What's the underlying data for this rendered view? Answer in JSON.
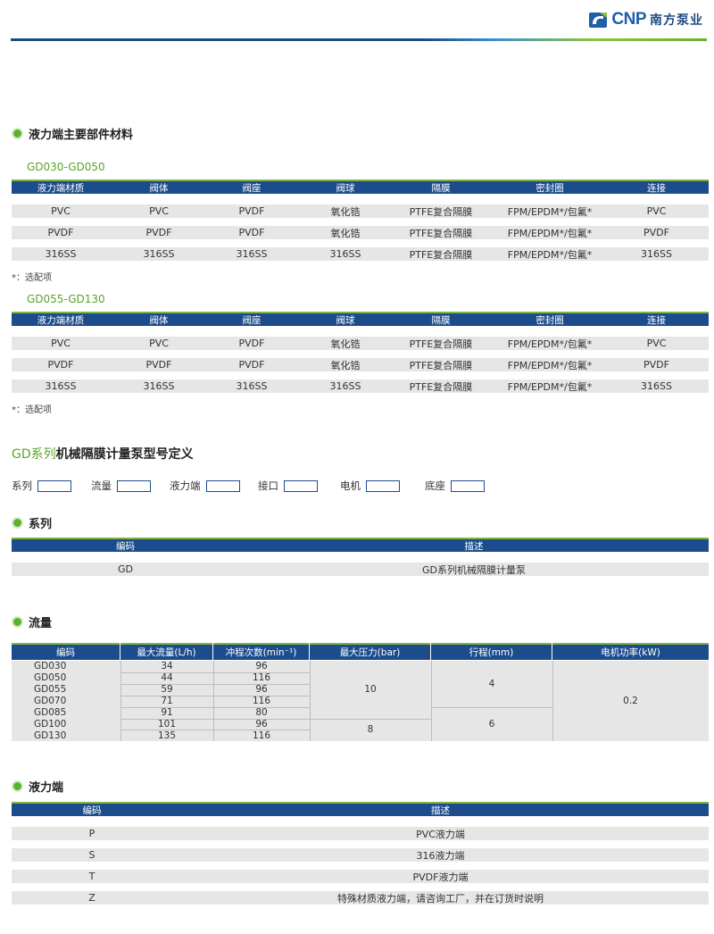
{
  "header": {
    "brand": "CNP",
    "brand_cn": "南方泵业"
  },
  "materials": {
    "title": "液力端主要部件材料",
    "columns": [
      "液力端材质",
      "阀体",
      "阀座",
      "阀球",
      "隔膜",
      "密封圈",
      "连接"
    ],
    "groups": [
      {
        "label": "GD030-GD050",
        "rows": [
          [
            "PVC",
            "PVC",
            "PVDF",
            "氧化锆",
            "PTFE复合隔膜",
            "FPM/EPDM*/包氟*",
            "PVC"
          ],
          [
            "PVDF",
            "PVDF",
            "PVDF",
            "氧化锆",
            "PTFE复合隔膜",
            "FPM/EPDM*/包氟*",
            "PVDF"
          ],
          [
            "316SS",
            "316SS",
            "316SS",
            "316SS",
            "PTFE复合隔膜",
            "FPM/EPDM*/包氟*",
            "316SS"
          ]
        ],
        "note": "*：选配项"
      },
      {
        "label": "GD055-GD130",
        "rows": [
          [
            "PVC",
            "PVC",
            "PVDF",
            "氧化锆",
            "PTFE复合隔膜",
            "FPM/EPDM*/包氟*",
            "PVC"
          ],
          [
            "PVDF",
            "PVDF",
            "PVDF",
            "氧化锆",
            "PTFE复合隔膜",
            "FPM/EPDM*/包氟*",
            "PVDF"
          ],
          [
            "316SS",
            "316SS",
            "316SS",
            "316SS",
            "PTFE复合隔膜",
            "FPM/EPDM*/包氟*",
            "316SS"
          ]
        ],
        "note": "*：选配项"
      }
    ]
  },
  "model_def": {
    "title_prefix": "GD系列",
    "title_rest": "机械隔膜计量泵型号定义",
    "fields": [
      "系列",
      "流量",
      "液力端",
      "接口",
      "电机",
      "底座"
    ]
  },
  "series": {
    "title": "系列",
    "columns": [
      "编码",
      "描述"
    ],
    "rows": [
      [
        "GD",
        "GD系列机械隔膜计量泵"
      ]
    ]
  },
  "flow": {
    "title": "流量",
    "columns": [
      "编码",
      "最大流量(L/h)",
      "冲程次数(min⁻¹)",
      "最大压力(bar)",
      "行程(mm)",
      "电机功率(kW)"
    ],
    "rows": [
      [
        "GD030",
        "34",
        "96"
      ],
      [
        "GD050",
        "44",
        "116"
      ],
      [
        "GD055",
        "59",
        "96"
      ],
      [
        "GD070",
        "71",
        "116"
      ],
      [
        "GD085",
        "91",
        "80"
      ],
      [
        "GD100",
        "101",
        "96"
      ],
      [
        "GD130",
        "135",
        "116"
      ]
    ],
    "pressure": [
      "10",
      "8"
    ],
    "stroke": [
      "4",
      "6"
    ],
    "power": "0.2"
  },
  "liquid_end": {
    "title": "液力端",
    "columns": [
      "编码",
      "描述"
    ],
    "rows": [
      [
        "P",
        "PVC液力端"
      ],
      [
        "S",
        "316液力端"
      ],
      [
        "T",
        "PVDF液力端"
      ],
      [
        "Z",
        "特殊材质液力端，请咨询工厂，并在订货时说明"
      ]
    ]
  },
  "colors": {
    "navy": "#1d4c8d",
    "green": "#5bb12f",
    "row_gray": "#e6e6e6"
  }
}
